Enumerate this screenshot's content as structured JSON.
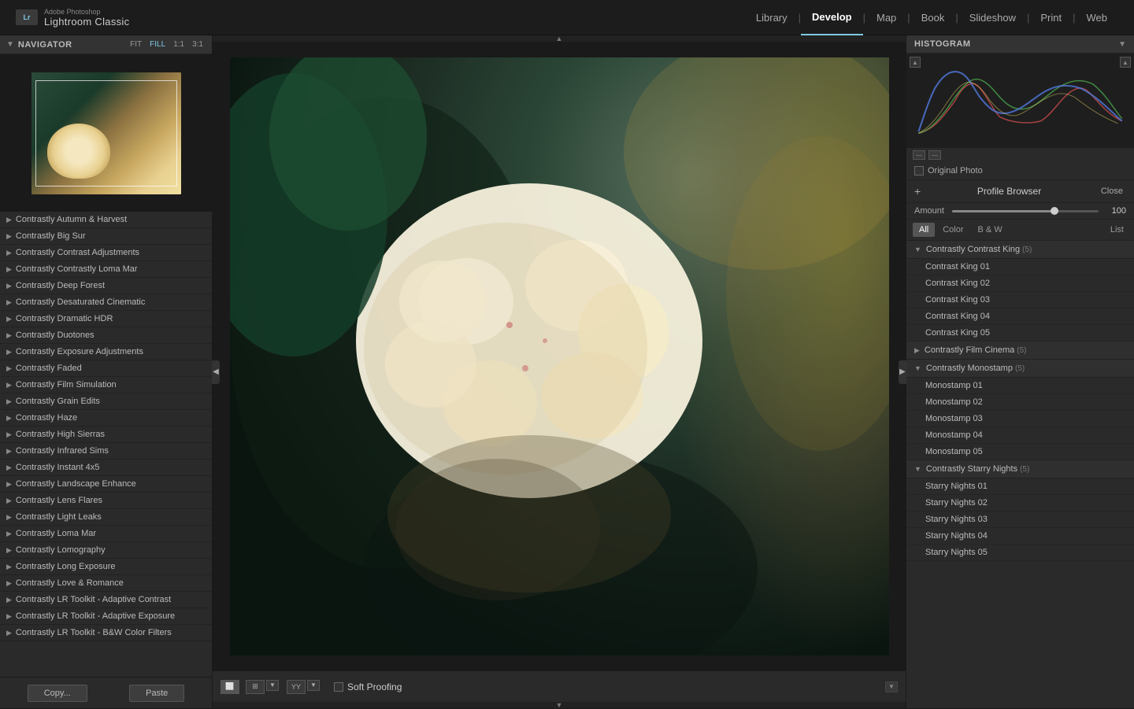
{
  "app": {
    "adobe_label": "Adobe Photoshop",
    "lr_label": "Lightroom Classic",
    "lr_abbr": "Lr"
  },
  "top_nav": {
    "items": [
      {
        "label": "Library",
        "active": false
      },
      {
        "label": "Develop",
        "active": true
      },
      {
        "label": "Map",
        "active": false
      },
      {
        "label": "Book",
        "active": false
      },
      {
        "label": "Slideshow",
        "active": false
      },
      {
        "label": "Print",
        "active": false
      },
      {
        "label": "Web",
        "active": false
      }
    ]
  },
  "navigator": {
    "title": "Navigator",
    "zoom_fit": "FIT",
    "zoom_fill": "FILL",
    "zoom_1_1": "1:1",
    "zoom_3_1": "3:1"
  },
  "presets": [
    "Contrastly Autumn & Harvest",
    "Contrastly Big Sur",
    "Contrastly Contrast Adjustments",
    "Contrastly Contrastly Loma Mar",
    "Contrastly Deep Forest",
    "Contrastly Desaturated Cinematic",
    "Contrastly Dramatic HDR",
    "Contrastly Duotones",
    "Contrastly Exposure Adjustments",
    "Contrastly Faded",
    "Contrastly Film Simulation",
    "Contrastly Grain Edits",
    "Contrastly Haze",
    "Contrastly High Sierras",
    "Contrastly Infrared Sims",
    "Contrastly Instant 4x5",
    "Contrastly Landscape Enhance",
    "Contrastly Lens Flares",
    "Contrastly Light Leaks",
    "Contrastly Loma Mar",
    "Contrastly Lomography",
    "Contrastly Long Exposure",
    "Contrastly Love & Romance",
    "Contrastly LR Toolkit - Adaptive Contrast",
    "Contrastly LR Toolkit - Adaptive Exposure",
    "Contrastly LR Toolkit - B&W Color Filters"
  ],
  "bottom_bar": {
    "copy_btn": "Copy...",
    "paste_btn": "Paste",
    "soft_proofing": "Soft Proofing"
  },
  "histogram": {
    "title": "Histogram"
  },
  "original_photo": {
    "label": "Original Photo"
  },
  "profile_browser": {
    "title": "Profile Browser",
    "add_btn": "+",
    "close_btn": "Close",
    "amount_label": "Amount",
    "amount_value": "100",
    "filters": [
      "All",
      "Color",
      "B & W"
    ],
    "active_filter": "All",
    "list_label": "List"
  },
  "profile_groups": [
    {
      "name": "Contrastly Contrast King",
      "count": "(5)",
      "expanded": true,
      "items": [
        "Contrast King 01",
        "Contrast King 02",
        "Contrast King 03",
        "Contrast King 04",
        "Contrast King 05"
      ]
    },
    {
      "name": "Contrastly Film Cinema",
      "count": "(5)",
      "expanded": false,
      "items": []
    },
    {
      "name": "Contrastly Monostamp",
      "count": "(5)",
      "expanded": true,
      "items": [
        "Monostamp 01",
        "Monostamp 02",
        "Monostamp 03",
        "Monostamp 04",
        "Monostamp 05"
      ]
    },
    {
      "name": "Contrastly Starry Nights",
      "count": "(5)",
      "expanded": true,
      "items": [
        "Starry Nights 01",
        "Starry Nights 02",
        "Starry Nights 03",
        "Starry Nights 04",
        "Starry Nights 05"
      ]
    }
  ]
}
